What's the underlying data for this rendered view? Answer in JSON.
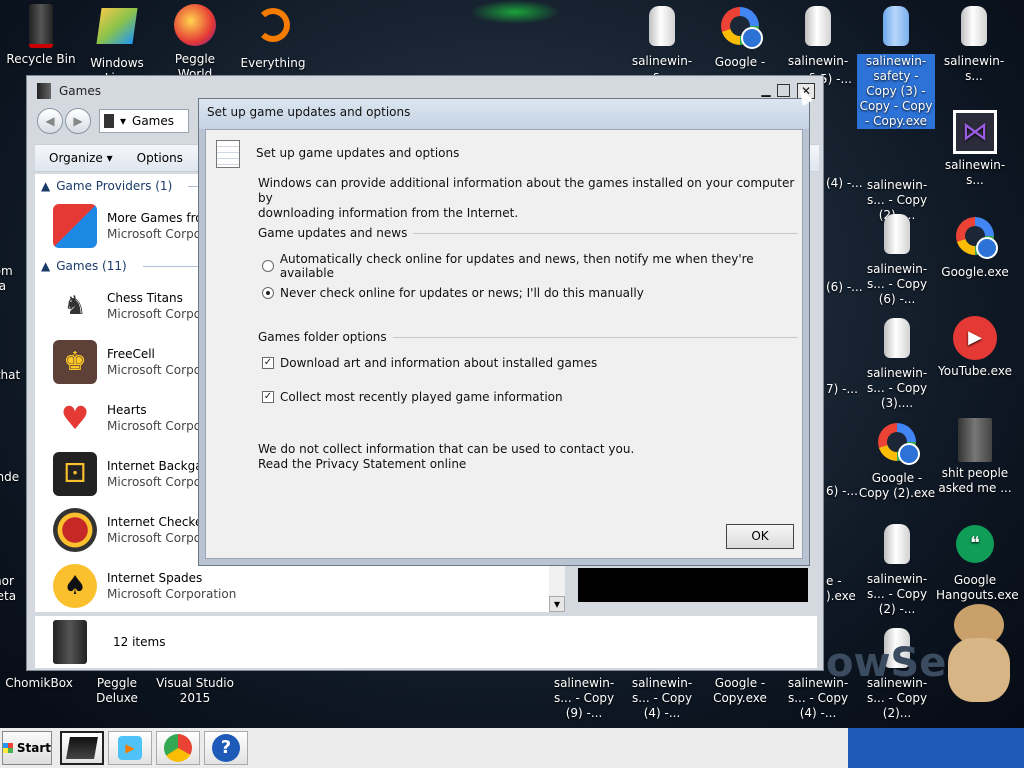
{
  "desktop": {
    "icons_left": [
      {
        "label": "Recycle Bin",
        "icon": "recycle-bin-icon"
      },
      {
        "label": "Windows Live",
        "icon": "windows-live-icon"
      },
      {
        "label": "Peggle World",
        "icon": "peggle-icon"
      },
      {
        "label": "Everything",
        "icon": "everything-search-icon"
      }
    ],
    "icons_top_right": [
      {
        "label": "salinewin-s...",
        "icon": "cup-icon"
      },
      {
        "label": "Google -",
        "icon": "chrome-icon"
      },
      {
        "label": "salinewin-s...",
        "icon": "cup-icon"
      },
      {
        "label": "salinewin-safety - Copy (3) - Copy - Copy - Copy.exe",
        "icon": "cup-icon"
      },
      {
        "label": "salinewin-s...",
        "icon": "cup-icon"
      }
    ],
    "col3": [
      {
        "label": "salinewin-s... - Copy (2) -...",
        "icon": "cup-icon"
      },
      {
        "label": "salinewin-s... - Copy (6) -...",
        "icon": "cup-icon"
      },
      {
        "label": "salinewin-s... - Copy (3)....",
        "icon": "cup-icon"
      },
      {
        "label": "Google - Copy (2).exe",
        "icon": "chrome-icon"
      },
      {
        "label": "salinewin-s... - Copy (2) -...",
        "icon": "cup-icon"
      },
      {
        "label": "salinewin-s... - Copy (2)...",
        "icon": "cup-icon"
      }
    ],
    "col4": [
      {
        "label": "salinewin-s...",
        "icon": "visual-studio-icon"
      },
      {
        "label": "Google.exe",
        "icon": "chrome-icon"
      },
      {
        "label": "YouTube.exe",
        "icon": "youtube-icon"
      },
      {
        "label": "shit people asked me ...",
        "icon": "folder-icon"
      },
      {
        "label": "Google Hangouts.exe",
        "icon": "hangouts-icon"
      }
    ],
    "bottom_row": [
      {
        "label": "ChomikBox"
      },
      {
        "label": "Peggle Deluxe"
      },
      {
        "label": "Visual Studio 2015"
      },
      {
        "label": "salinewin-s... - Copy (9) -..."
      },
      {
        "label": "salinewin-s... - Copy (4) -..."
      },
      {
        "label": "Google - Copy.exe"
      },
      {
        "label": "salinewin-s... - Copy (4) -..."
      }
    ],
    "partial_left": [
      "som",
      "ra",
      "that",
      "Ende",
      "nor",
      "reta"
    ],
    "partial_mid": [
      "(4) -...",
      "(6) -...",
      "7) -...",
      "6) -...",
      "e -",
      ").exe",
      "5) -..."
    ],
    "bg_text": "owSe"
  },
  "games_window": {
    "title": "Games",
    "address": "Games",
    "toolbar": {
      "organize": "Organize",
      "options": "Options",
      "more": "T"
    },
    "groups": [
      {
        "label": "Game Providers (1)"
      },
      {
        "label": "Games (11)"
      }
    ],
    "providers": [
      {
        "name": "More Games from",
        "publisher": "Microsoft Corpor",
        "icon": "puzzle-icon"
      }
    ],
    "games": [
      {
        "name": "Chess Titans",
        "publisher": "Microsoft Corpor",
        "icon": "chess-icon"
      },
      {
        "name": "FreeCell",
        "publisher": "Microsoft Corpor",
        "icon": "freecell-icon"
      },
      {
        "name": "Hearts",
        "publisher": "Microsoft Corpor",
        "icon": "hearts-icon"
      },
      {
        "name": "Internet Backgam",
        "publisher": "Microsoft Corpor",
        "icon": "backgammon-icon"
      },
      {
        "name": "Internet Checkers",
        "publisher": "Microsoft Corpor",
        "icon": "checkers-icon"
      },
      {
        "name": "Internet Spades",
        "publisher": "Microsoft Corporation",
        "icon": "spades-icon"
      }
    ],
    "status": "12 items"
  },
  "dialog": {
    "title": "Set up game updates and options",
    "heading": "Set up game updates and options",
    "intro_line1": "Windows can provide additional information about the games installed on your computer by",
    "intro_line2": "downloading information from the Internet.",
    "section_updates": "Game updates and news",
    "radio_auto": "Automatically check online for updates and news, then notify me when they're available",
    "radio_never": "Never check online for updates or news; I'll do this manually",
    "section_folder": "Games folder options",
    "check_download": "Download art and information about installed games",
    "check_collect": "Collect most recently played game information",
    "privacy_line1": "We do not collect information that can be used to contact you.",
    "privacy_link": "Read the Privacy Statement online",
    "ok": "OK",
    "selected_radio": "never",
    "checks": {
      "download": true,
      "collect": true
    }
  },
  "taskbar": {
    "start": "Start",
    "items": [
      {
        "icon": "games-folder-icon"
      },
      {
        "icon": "media-icon"
      },
      {
        "icon": "chrome-icon"
      },
      {
        "icon": "help-icon"
      }
    ]
  }
}
